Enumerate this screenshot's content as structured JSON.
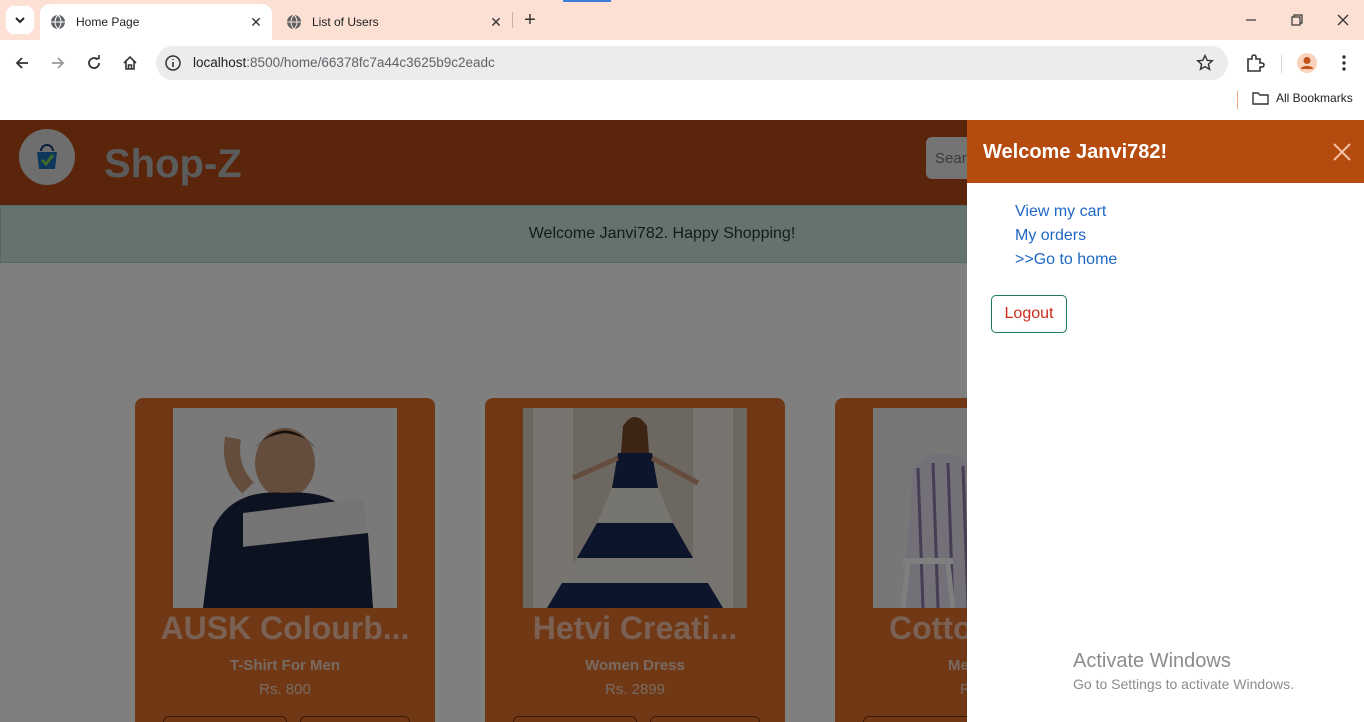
{
  "browser": {
    "tabs": [
      {
        "title": "Home Page",
        "active": true
      },
      {
        "title": "List of Users",
        "active": false
      }
    ],
    "url_host": "localhost",
    "url_path": ":8500/home/66378fc7a44c3625b9c2eadc",
    "bookmarks_label": "All Bookmarks",
    "icons": {
      "tab_search": "chevron-down-icon",
      "new_tab": "plus-icon",
      "back": "arrow-left-icon",
      "forward": "arrow-right-icon",
      "reload": "reload-icon",
      "home": "home-icon",
      "site_info": "info-icon",
      "bookmark_star": "star-icon",
      "extensions": "puzzle-icon",
      "profile": "avatar-icon",
      "menu": "kebab-menu-icon"
    }
  },
  "site": {
    "brand": "Shop-Z",
    "search_placeholder": "Sear",
    "welcome_alert": "Welcome Janvi782. Happy Shopping!",
    "colors": {
      "header": "#b54b14",
      "card": "#e0702a"
    }
  },
  "products": [
    {
      "name": "AUSK Colourb...",
      "category": "T-Shirt For Men",
      "price": "Rs. 800"
    },
    {
      "name": "Hetvi Creati...",
      "category": "Women Dress",
      "price": "Rs. 2899"
    },
    {
      "name": "Cotto",
      "category": "Me",
      "price": "R"
    }
  ],
  "offcanvas": {
    "title": "Welcome Janvi782!",
    "links": [
      "View my cart",
      "My orders",
      ">>Go to home"
    ],
    "logout_label": "Logout"
  },
  "watermark": {
    "line1": "Activate Windows",
    "line2": "Go to Settings to activate Windows."
  }
}
